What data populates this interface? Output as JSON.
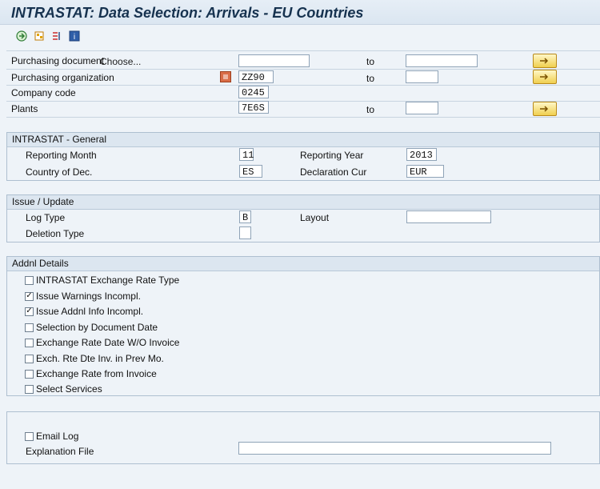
{
  "window": {
    "title": "INTRASTAT: Data Selection: Arrivals - EU Countries"
  },
  "toolbar": {
    "icons": [
      "execute-icon",
      "variant-icon",
      "selection-options-icon",
      "info-icon"
    ],
    "choose_label": "Choose..."
  },
  "selection": {
    "purchasing_document": {
      "label": "Purchasing document",
      "from": "",
      "to_label": "to",
      "to": ""
    },
    "purchasing_organization": {
      "label": "Purchasing organization",
      "from": "ZZ90",
      "to_label": "to",
      "to": ""
    },
    "company_code": {
      "label": "Company code",
      "value": "0245"
    },
    "plants": {
      "label": "Plants",
      "from": "7E6S",
      "to_label": "to",
      "to": ""
    }
  },
  "groups": {
    "general": {
      "title": "INTRASTAT - General",
      "reporting_month_label": "Reporting Month",
      "reporting_month": "11",
      "reporting_year_label": "Reporting Year",
      "reporting_year": "2013",
      "country_label": "Country of Dec.",
      "country": "ES",
      "declaration_cur_label": "Declaration Cur",
      "declaration_cur": "EUR"
    },
    "issue": {
      "title": "Issue / Update",
      "log_type_label": "Log Type",
      "log_type": "B",
      "layout_label": "Layout",
      "layout": "",
      "deletion_type_label": "Deletion Type",
      "deletion_type": ""
    },
    "details": {
      "title": "Addnl Details",
      "items": [
        {
          "label": "INTRASTAT Exchange Rate Type",
          "checked": false
        },
        {
          "label": "Issue Warnings Incompl.",
          "checked": true
        },
        {
          "label": "Issue Addnl Info Incompl.",
          "checked": true
        },
        {
          "label": "Selection by Document Date",
          "checked": false
        },
        {
          "label": "Exchange Rate Date W/O Invoice",
          "checked": false
        },
        {
          "label": "Exch. Rte Dte Inv. in Prev Mo.",
          "checked": false
        },
        {
          "label": "Exchange Rate from Invoice",
          "checked": false
        },
        {
          "label": "Select Services",
          "checked": false
        }
      ]
    },
    "output": {
      "email_log_label": "Email Log",
      "email_log_checked": false,
      "explanation_label": "Explanation File",
      "explanation": ""
    }
  },
  "colors": {
    "background": "#eef3f8",
    "header": "#dce6f0",
    "border": "#aebfd0",
    "title": "#16324f"
  }
}
